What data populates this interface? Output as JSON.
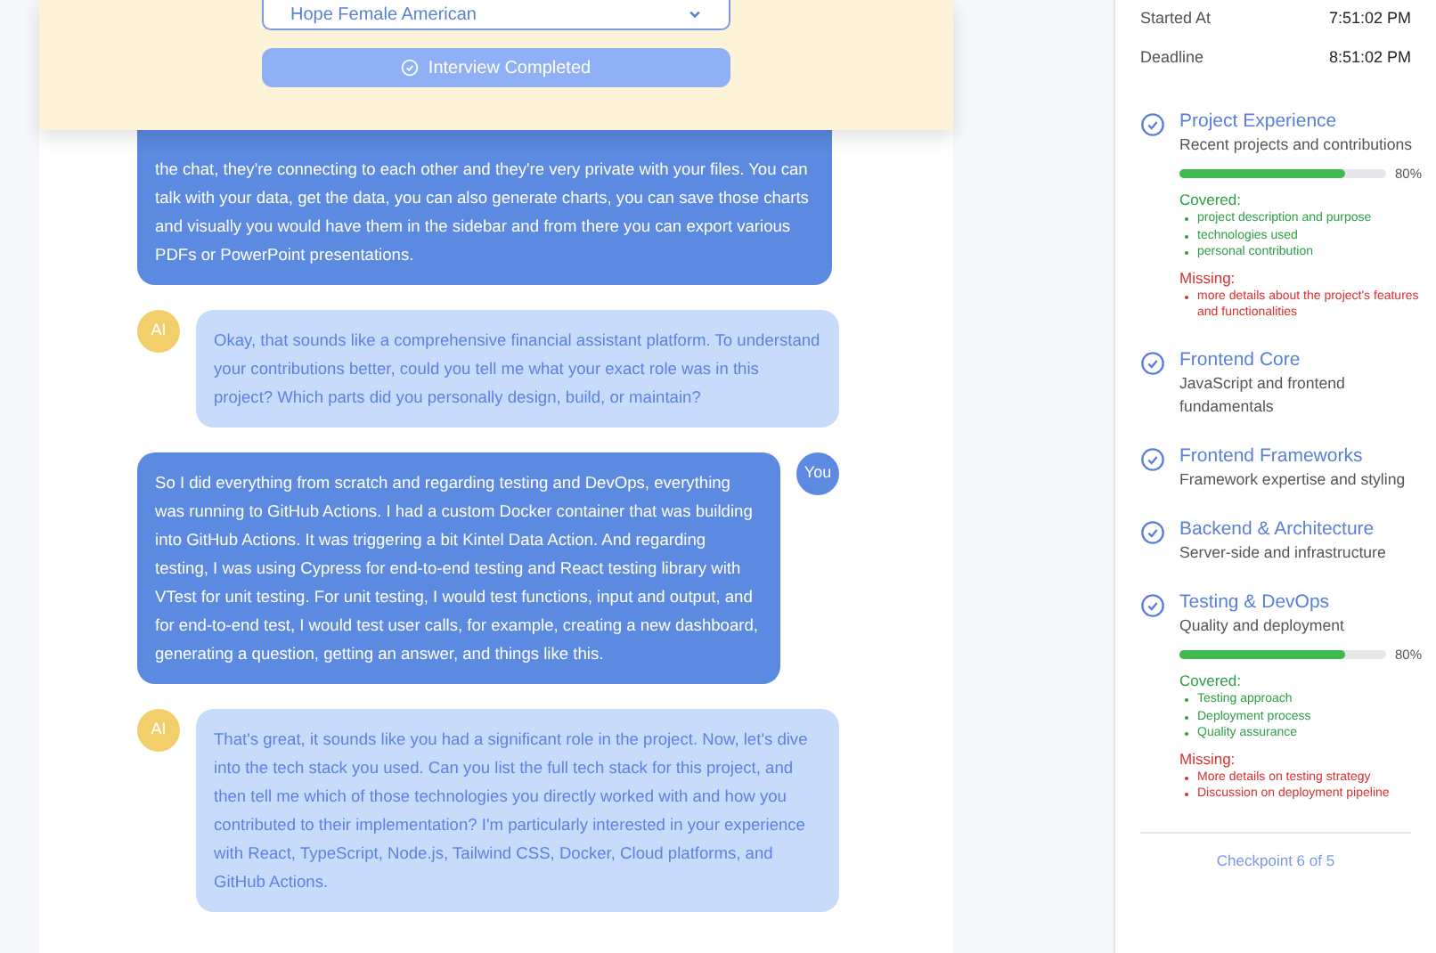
{
  "header": {
    "voice_select": {
      "value": "Hope Female American"
    },
    "status_button": {
      "label": "Interview Completed",
      "disabled": true
    }
  },
  "messages": [
    {
      "kind": "user",
      "text": "the chat, they're connecting to each other and they're very private with your files. You can talk with your data, get the data, you can also generate charts, you can save those charts and visually you would have them in the sidebar and from there you can export various PDFs or PowerPoint presentations."
    },
    {
      "kind": "ai",
      "avatar": "AI",
      "text": "Okay, that sounds like a comprehensive financial assistant platform. To understand your contributions better, could you tell me what your exact role was in this project? Which parts did you personally design, build, or maintain?"
    },
    {
      "kind": "user",
      "avatar": "You",
      "text": "So I did everything from scratch and regarding testing and DevOps, everything was running to GitHub Actions. I had a custom Docker container that was building into GitHub Actions. It was triggering a bit Kintel Data Action. And regarding testing, I was using Cypress for end-to-end testing and React testing library with VTest for unit testing. For unit testing, I would test functions, input and output, and for end-to-end test, I would test user calls, for example, creating a new dashboard, generating a question, getting an answer, and things like this."
    },
    {
      "kind": "ai",
      "avatar": "AI",
      "text": "That's great, it sounds like you had a significant role in the project. Now, let's dive into the tech stack you used. Can you list the full tech stack for this project, and then tell me which of those technologies you directly worked with and how you contributed to their implementation? I'm particularly interested in your experience with React, TypeScript, Node.js, Tailwind CSS, Docker, Cloud platforms, and GitHub Actions."
    }
  ],
  "session": [
    {
      "label": "Started At",
      "value": "7:51:02 PM"
    },
    {
      "label": "Deadline",
      "value": "8:51:02 PM"
    }
  ],
  "checkpoints": [
    {
      "title": "Project Experience",
      "subtitle": "Recent projects and contributions",
      "progress": {
        "level": 0.8,
        "reading": "80%"
      },
      "covered_label": "Covered:",
      "covered": [
        "project description and purpose",
        "technologies used",
        "personal contribution"
      ],
      "missing_label": "Missing:",
      "missing": [
        "more details about the project's features and functionalities"
      ]
    },
    {
      "title": "Frontend Core",
      "subtitle": "JavaScript and frontend fundamentals"
    },
    {
      "title": "Frontend Frameworks",
      "subtitle": "Framework expertise and styling"
    },
    {
      "title": "Backend & Architecture",
      "subtitle": "Server-side and infrastructure"
    },
    {
      "title": "Testing & DevOps",
      "subtitle": "Quality and deployment",
      "progress": {
        "level": 0.8,
        "reading": "80%"
      },
      "covered_label": "Covered:",
      "covered": [
        "Testing approach",
        "Deployment process",
        "Quality assurance"
      ],
      "missing_label": "Missing:",
      "missing": [
        "More details on testing strategy",
        "Discussion on deployment pipeline"
      ]
    }
  ],
  "footer": "Checkpoint 6 of 5"
}
